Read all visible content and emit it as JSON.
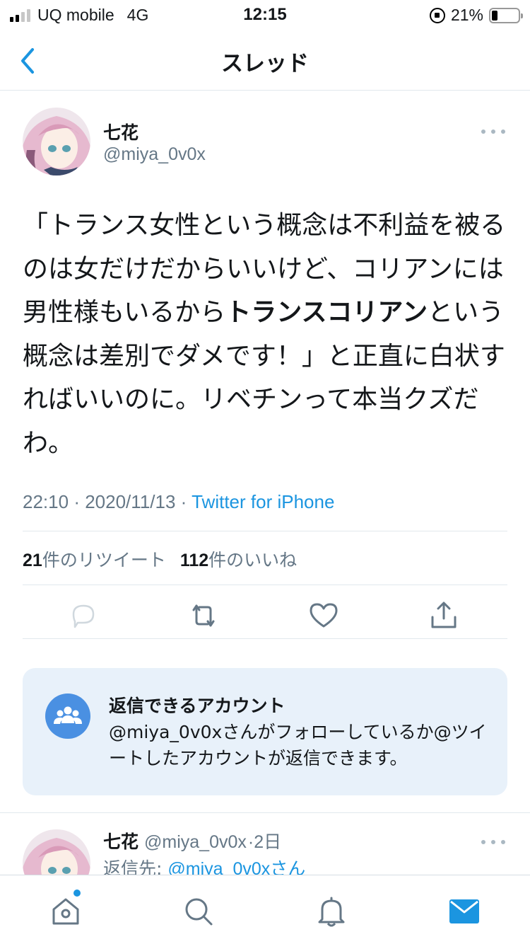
{
  "status_bar": {
    "carrier": "UQ mobile",
    "network": "4G",
    "time": "12:15",
    "battery": "21%",
    "battery_level": 0.21,
    "signal_bars_on": 2,
    "signal_bars_total": 4
  },
  "nav": {
    "title": "スレッド",
    "back_icon": "chevron-left-icon"
  },
  "tweet": {
    "display_name": "七花",
    "handle": "@miya_0v0x",
    "text_segments": [
      {
        "text": "「トランス女性という概念は不利益を被るのは女だけだからいいけど、コリアンには男性様もいるから",
        "bold": false
      },
      {
        "text": "トランスコリアン",
        "bold": true
      },
      {
        "text": "という概念は差別でダメです！」と正直に白状すればいいのに。リベチンって本当クズだわ。",
        "bold": false
      }
    ],
    "time": "22:10",
    "date": "2020/11/13",
    "separator": "·",
    "via": "Twitter for iPhone",
    "retweet_count": "21",
    "retweet_label": "件のリツイート",
    "like_count": "112",
    "like_label": "件のいいね"
  },
  "reply_restriction": {
    "title": "返信できるアカウント",
    "description": "@miya_0v0xさんがフォローしているか@ツイートしたアカウントが返信できます。",
    "icon": "people-icon"
  },
  "reply_tweet": {
    "display_name": "七花",
    "handle": "@miya_0v0x",
    "age": "·2日",
    "reply_to_prefix": "返信先: ",
    "reply_to_handle": "@miya_0v0xさん"
  },
  "colors": {
    "accent": "#1b95e0",
    "secondary_text": "#657786",
    "reply_box_bg": "#e8f1fa",
    "reply_icon_bg": "#4a90e2"
  }
}
